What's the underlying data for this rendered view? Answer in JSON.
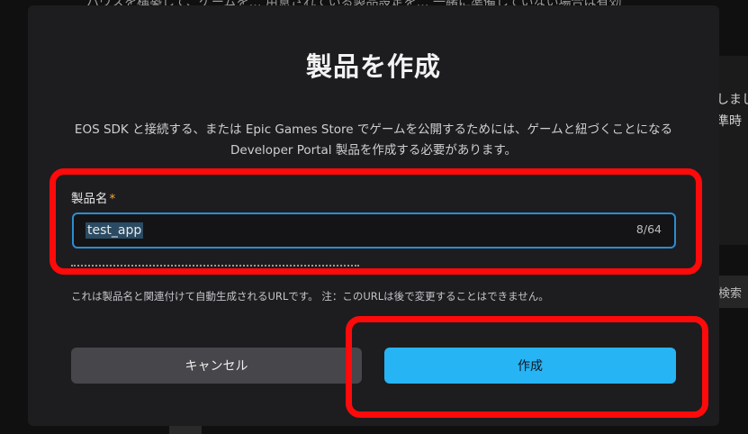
{
  "modal": {
    "title": "製品を作成",
    "description": "EOS SDK と接続する、または Epic Games Store でゲームを公開するためには、ゲームと紐づくことになる Developer Portal 製品を作成する必要があります。",
    "name_field": {
      "label": "製品名",
      "required_mark": "*",
      "value": "test_app",
      "counter": "8/64"
    },
    "url_help": "これは製品名と関連付けて自動生成されるURLです。 注：このURLは後で変更することはできません。",
    "buttons": {
      "cancel": "キャンセル",
      "create": "作成"
    }
  },
  "background": {
    "top_text": "ハウスを構築して、ゲームを… 用意されている製品設定を… 一緒に準備していない場合は有効",
    "right_text_1": "しまし",
    "right_text_2": "準時",
    "search_label": "検索"
  },
  "colors": {
    "modal_bg": "#1d1d20",
    "accent_blue": "#27b4f5",
    "focus_border": "#2d8cd0",
    "required_star": "#f2a93b",
    "annotation_red": "#ff0a0a"
  }
}
